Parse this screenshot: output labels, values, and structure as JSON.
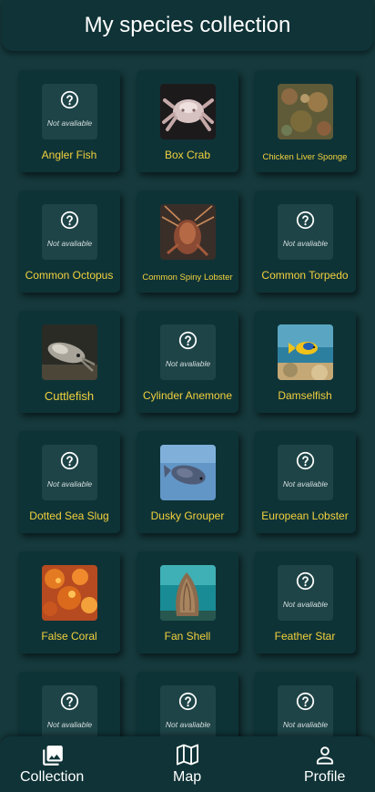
{
  "header": {
    "title": "My species collection"
  },
  "placeholder_text": "Not avaliable",
  "species": [
    {
      "name": "Angler Fish",
      "image": null
    },
    {
      "name": "Box Crab",
      "image": "crab"
    },
    {
      "name": "Chicken Liver Sponge",
      "image": "sponge"
    },
    {
      "name": "Common Octopus",
      "image": null
    },
    {
      "name": "Common Spiny Lobster",
      "image": "lobster"
    },
    {
      "name": "Common Torpedo",
      "image": null
    },
    {
      "name": "Cuttlefish",
      "image": "cuttlefish"
    },
    {
      "name": "Cylinder Anemone",
      "image": null
    },
    {
      "name": "Damselfish",
      "image": "damselfish"
    },
    {
      "name": "Dotted Sea Slug",
      "image": null
    },
    {
      "name": "Dusky Grouper",
      "image": "grouper"
    },
    {
      "name": "European Lobster",
      "image": null
    },
    {
      "name": "False Coral",
      "image": "coral"
    },
    {
      "name": "Fan Shell",
      "image": "fanshell"
    },
    {
      "name": "Feather Star",
      "image": null
    },
    {
      "name": "",
      "image": null
    },
    {
      "name": "",
      "image": null
    },
    {
      "name": "",
      "image": null
    }
  ],
  "nav": {
    "collection": "Collection",
    "map": "Map",
    "profile": "Profile"
  },
  "colors": {
    "background": "#15393c",
    "card": "#0e3337",
    "species_name": "#f2d13c"
  }
}
